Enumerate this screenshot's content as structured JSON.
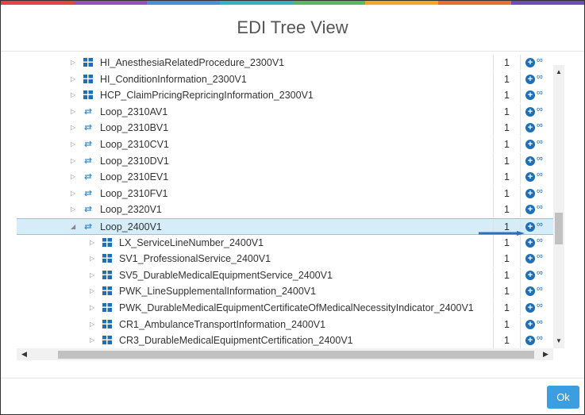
{
  "dialog": {
    "title": "EDI Tree View",
    "ok_label": "Ok",
    "accent_color": "#3a9ee0"
  },
  "rainbow_colors": [
    "#e8433f",
    "#9b4fbf",
    "#4a90d9",
    "#34b2c9",
    "#5bb85c",
    "#f5a623",
    "#ef6c2f",
    "#6a4fb6"
  ],
  "tree": {
    "rows": [
      {
        "label": "HI_AnesthesiaRelatedProcedure_2300V1",
        "count": "1",
        "icon": "segment-icon",
        "level": 1,
        "expanded": false,
        "selected": false
      },
      {
        "label": "HI_ConditionInformation_2300V1",
        "count": "1",
        "icon": "segment-icon",
        "level": 1,
        "expanded": false,
        "selected": false
      },
      {
        "label": "HCP_ClaimPricingRepricingInformation_2300V1",
        "count": "1",
        "icon": "segment-icon",
        "level": 1,
        "expanded": false,
        "selected": false
      },
      {
        "label": "Loop_2310AV1",
        "count": "1",
        "icon": "loop-icon",
        "level": 1,
        "expanded": false,
        "selected": false
      },
      {
        "label": "Loop_2310BV1",
        "count": "1",
        "icon": "loop-icon",
        "level": 1,
        "expanded": false,
        "selected": false
      },
      {
        "label": "Loop_2310CV1",
        "count": "1",
        "icon": "loop-icon",
        "level": 1,
        "expanded": false,
        "selected": false
      },
      {
        "label": "Loop_2310DV1",
        "count": "1",
        "icon": "loop-icon",
        "level": 1,
        "expanded": false,
        "selected": false
      },
      {
        "label": "Loop_2310EV1",
        "count": "1",
        "icon": "loop-icon",
        "level": 1,
        "expanded": false,
        "selected": false
      },
      {
        "label": "Loop_2310FV1",
        "count": "1",
        "icon": "loop-icon",
        "level": 1,
        "expanded": false,
        "selected": false
      },
      {
        "label": "Loop_2320V1",
        "count": "1",
        "icon": "loop-icon",
        "level": 1,
        "expanded": false,
        "selected": false
      },
      {
        "label": "Loop_2400V1",
        "count": "1",
        "icon": "loop-icon",
        "level": 1,
        "expanded": true,
        "selected": true
      },
      {
        "label": "LX_ServiceLineNumber_2400V1",
        "count": "1",
        "icon": "segment-icon",
        "level": 2,
        "expanded": false,
        "selected": false
      },
      {
        "label": "SV1_ProfessionalService_2400V1",
        "count": "1",
        "icon": "segment-icon",
        "level": 2,
        "expanded": false,
        "selected": false
      },
      {
        "label": "SV5_DurableMedicalEquipmentService_2400V1",
        "count": "1",
        "icon": "segment-icon",
        "level": 2,
        "expanded": false,
        "selected": false
      },
      {
        "label": "PWK_LineSupplementalInformation_2400V1",
        "count": "1",
        "icon": "segment-icon",
        "level": 2,
        "expanded": false,
        "selected": false
      },
      {
        "label": "PWK_DurableMedicalEquipmentCertificateOfMedicalNecessityIndicator_2400V1",
        "count": "1",
        "icon": "segment-icon",
        "level": 2,
        "expanded": false,
        "selected": false
      },
      {
        "label": "CR1_AmbulanceTransportInformation_2400V1",
        "count": "1",
        "icon": "segment-icon",
        "level": 2,
        "expanded": false,
        "selected": false
      },
      {
        "label": "CR3_DurableMedicalEquipmentCertification_2400V1",
        "count": "1",
        "icon": "segment-icon",
        "level": 2,
        "expanded": false,
        "selected": false
      }
    ],
    "add_icon": "plus-circle-icon",
    "link_icon": "link-icon"
  }
}
